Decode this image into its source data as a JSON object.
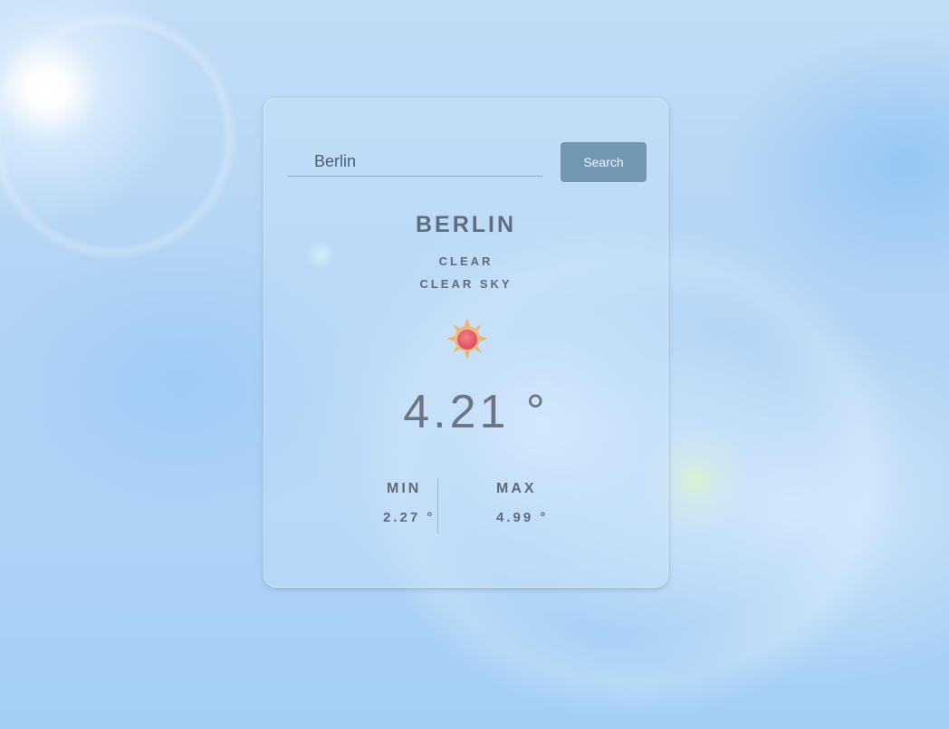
{
  "search": {
    "value": "Berlin",
    "button_label": "Search"
  },
  "weather": {
    "city": "BERLIN",
    "condition": "CLEAR",
    "description": "CLEAR SKY",
    "icon": "sun-icon",
    "temperature": "4.21 °",
    "min_label": "MIN",
    "min_value": "2.27 °",
    "max_label": "MAX",
    "max_value": "4.99 °"
  },
  "colors": {
    "button": "#7297b3",
    "text": "#5e6e7e",
    "sun_core": "#e85a6a",
    "sun_rays": "#f0a860"
  }
}
